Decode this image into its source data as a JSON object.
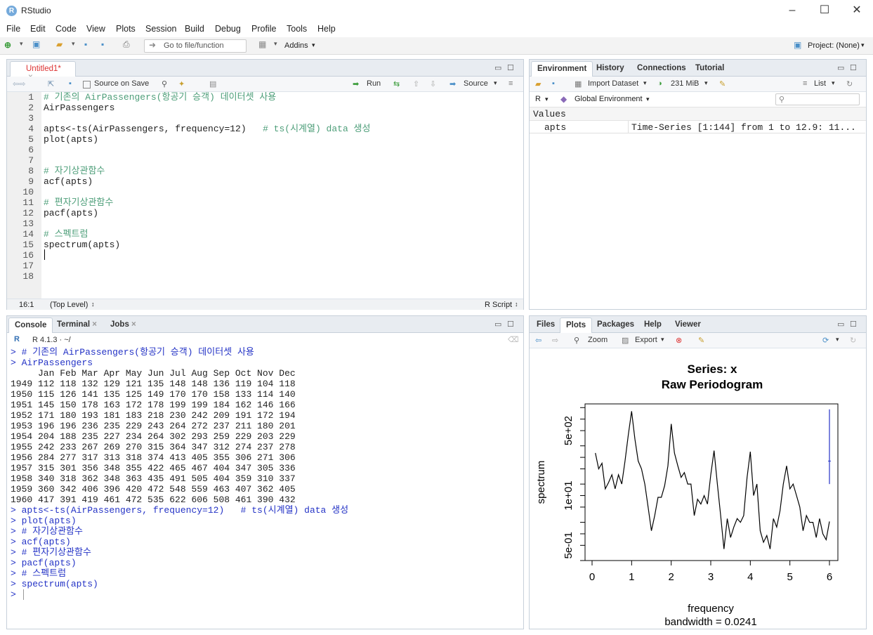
{
  "window": {
    "title": "RStudio",
    "logo": "R",
    "minimize": "–",
    "maximize": "☐",
    "close": "✕"
  },
  "menu": [
    "File",
    "Edit",
    "Code",
    "View",
    "Plots",
    "Session",
    "Build",
    "Debug",
    "Profile",
    "Tools",
    "Help"
  ],
  "toolbar": {
    "goto_placeholder": "Go to file/function",
    "addins": "Addins",
    "project": "Project: (None)"
  },
  "editor": {
    "tab_label": "Untitled1*",
    "source_on_save": "Source on Save",
    "run": "Run",
    "source": "Source",
    "status_pos": "16:1",
    "status_scope": "(Top Level)",
    "status_type": "R Script",
    "lines": [
      "# 기존의 AirPassengers(항공기 승객) 데이터셋 사용",
      "AirPassengers",
      "",
      "apts<-ts(AirPassengers, frequency=12)   # ts(시계열) data 생성",
      "plot(apts)",
      "",
      "",
      "# 자기상관함수",
      "acf(apts)",
      "",
      "# 편자기상관함수",
      "pacf(apts)",
      "",
      "# 스펙트럼",
      "spectrum(apts)",
      "",
      "",
      ""
    ],
    "line_numbers": [
      "1",
      "2",
      "3",
      "4",
      "5",
      "6",
      "7",
      "8",
      "9",
      "10",
      "11",
      "12",
      "13",
      "14",
      "15",
      "16",
      "17",
      "18"
    ]
  },
  "console": {
    "tabs": [
      "Console",
      "Terminal",
      "Jobs"
    ],
    "r_version": "R 4.1.3 · ~/",
    "lines": [
      {
        "t": "in",
        "s": "> # 기존의 AirPassengers(항공기 승객) 데이터셋 사용"
      },
      {
        "t": "in",
        "s": "> AirPassengers"
      },
      {
        "t": "out",
        "s": "     Jan Feb Mar Apr May Jun Jul Aug Sep Oct Nov Dec"
      },
      {
        "t": "out",
        "s": "1949 112 118 132 129 121 135 148 148 136 119 104 118"
      },
      {
        "t": "out",
        "s": "1950 115 126 141 135 125 149 170 170 158 133 114 140"
      },
      {
        "t": "out",
        "s": "1951 145 150 178 163 172 178 199 199 184 162 146 166"
      },
      {
        "t": "out",
        "s": "1952 171 180 193 181 183 218 230 242 209 191 172 194"
      },
      {
        "t": "out",
        "s": "1953 196 196 236 235 229 243 264 272 237 211 180 201"
      },
      {
        "t": "out",
        "s": "1954 204 188 235 227 234 264 302 293 259 229 203 229"
      },
      {
        "t": "out",
        "s": "1955 242 233 267 269 270 315 364 347 312 274 237 278"
      },
      {
        "t": "out",
        "s": "1956 284 277 317 313 318 374 413 405 355 306 271 306"
      },
      {
        "t": "out",
        "s": "1957 315 301 356 348 355 422 465 467 404 347 305 336"
      },
      {
        "t": "out",
        "s": "1958 340 318 362 348 363 435 491 505 404 359 310 337"
      },
      {
        "t": "out",
        "s": "1959 360 342 406 396 420 472 548 559 463 407 362 405"
      },
      {
        "t": "out",
        "s": "1960 417 391 419 461 472 535 622 606 508 461 390 432"
      },
      {
        "t": "in",
        "s": "> apts<-ts(AirPassengers, frequency=12)   # ts(시계열) data 생성"
      },
      {
        "t": "in",
        "s": "> plot(apts)"
      },
      {
        "t": "in",
        "s": "> # 자기상관함수"
      },
      {
        "t": "in",
        "s": "> acf(apts)"
      },
      {
        "t": "in",
        "s": "> # 편자기상관함수"
      },
      {
        "t": "in",
        "s": "> pacf(apts)"
      },
      {
        "t": "in",
        "s": "> # 스펙트럼"
      },
      {
        "t": "in",
        "s": "> spectrum(apts)"
      },
      {
        "t": "in",
        "s": "> "
      }
    ]
  },
  "environment": {
    "tabs": [
      "Environment",
      "History",
      "Connections",
      "Tutorial"
    ],
    "import_dataset": "Import Dataset",
    "memory": "231 MiB",
    "list_view": "List",
    "lang": "R",
    "scope": "Global Environment",
    "section": "Values",
    "rows": [
      {
        "name": "apts",
        "value": "Time-Series [1:144] from 1 to 12.9: 11..."
      }
    ]
  },
  "files": {
    "tabs": [
      "Files",
      "Plots",
      "Packages",
      "Help",
      "Viewer"
    ],
    "zoom": "Zoom",
    "export": "Export"
  },
  "chart_data": {
    "type": "line",
    "title": "Series: x",
    "subtitle": "Raw Periodogram",
    "xlabel": "frequency",
    "xlabel2": "bandwidth = 0.0241",
    "ylabel": "spectrum",
    "log_y": true,
    "xlim": [
      0,
      6
    ],
    "ylim": [
      0.2,
      2500
    ],
    "x_ticks": [
      "0",
      "1",
      "2",
      "3",
      "4",
      "5",
      "6"
    ],
    "y_ticks": [
      {
        "label": "5e-01",
        "v": 0.5
      },
      {
        "label": "1e+01",
        "v": 10
      },
      {
        "label": "5e+02",
        "v": 500
      }
    ],
    "ci_bar": {
      "x": 6,
      "low": 20,
      "high": 1800,
      "center": 80
    },
    "x": [
      0.083,
      0.167,
      0.25,
      0.333,
      0.417,
      0.5,
      0.583,
      0.667,
      0.75,
      0.833,
      0.917,
      1.0,
      1.083,
      1.167,
      1.25,
      1.333,
      1.417,
      1.5,
      1.583,
      1.667,
      1.75,
      1.833,
      1.917,
      2.0,
      2.083,
      2.167,
      2.25,
      2.333,
      2.417,
      2.5,
      2.583,
      2.667,
      2.75,
      2.833,
      2.917,
      3.0,
      3.083,
      3.167,
      3.25,
      3.333,
      3.417,
      3.5,
      3.583,
      3.667,
      3.75,
      3.833,
      3.917,
      4.0,
      4.083,
      4.167,
      4.25,
      4.333,
      4.417,
      4.5,
      4.583,
      4.667,
      4.75,
      4.833,
      4.917,
      5.0,
      5.083,
      5.167,
      5.25,
      5.333,
      5.417,
      5.5,
      5.583,
      5.667,
      5.75,
      5.833,
      5.917,
      6.0
    ],
    "values": [
      130,
      50,
      70,
      15,
      22,
      35,
      15,
      35,
      20,
      80,
      400,
      1600,
      300,
      80,
      50,
      20,
      5,
      1.2,
      3,
      9,
      9,
      18,
      60,
      750,
      130,
      60,
      30,
      40,
      20,
      20,
      3,
      8,
      6,
      10,
      6,
      35,
      150,
      20,
      3,
      0.4,
      2.5,
      0.8,
      1.5,
      2.5,
      2,
      3,
      30,
      140,
      10,
      20,
      1.2,
      0.6,
      0.9,
      0.4,
      2.5,
      1.5,
      4,
      20,
      60,
      15,
      20,
      10,
      5,
      1.2,
      3,
      2,
      2,
      0.8,
      2.5,
      1,
      0.7,
      2.1
    ]
  }
}
